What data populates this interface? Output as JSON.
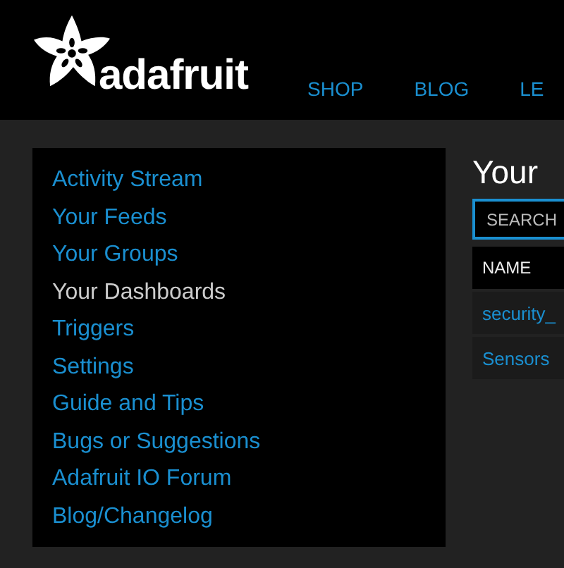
{
  "header": {
    "logo": "adafruit",
    "nav": [
      "SHOP",
      "BLOG",
      "LE"
    ]
  },
  "sidebar": {
    "items": [
      {
        "label": "Activity Stream",
        "selected": false
      },
      {
        "label": "Your Feeds",
        "selected": false
      },
      {
        "label": "Your Groups",
        "selected": false
      },
      {
        "label": "Your Dashboards",
        "selected": true
      },
      {
        "label": "Triggers",
        "selected": false
      },
      {
        "label": "Settings",
        "selected": false
      },
      {
        "label": "Guide and Tips",
        "selected": false
      },
      {
        "label": "Bugs or Suggestions",
        "selected": false
      },
      {
        "label": "Adafruit IO Forum",
        "selected": false
      },
      {
        "label": "Blog/Changelog",
        "selected": false
      }
    ]
  },
  "main": {
    "title": "Your",
    "search": {
      "placeholder": "SEARCH"
    },
    "table": {
      "columns": [
        "NAME"
      ],
      "rows": [
        [
          "security_"
        ],
        [
          "Sensors"
        ]
      ]
    }
  }
}
